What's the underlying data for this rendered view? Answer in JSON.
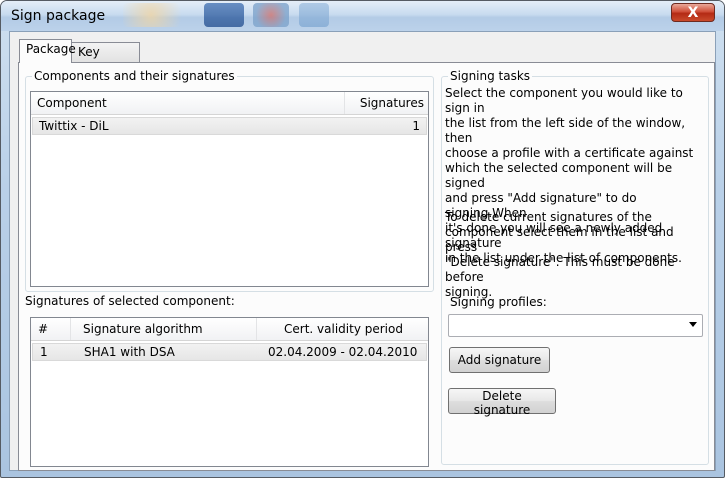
{
  "window": {
    "title": "Sign package",
    "close_label": "X"
  },
  "tabs": [
    {
      "label": "Package",
      "active": true
    },
    {
      "label": "Key pairs",
      "active": false
    }
  ],
  "components": {
    "group_title": "Components and their signatures",
    "headers": {
      "component": "Component",
      "signatures": "Signatures"
    },
    "rows": [
      {
        "component": "Twittix - DiL",
        "signatures": "1"
      }
    ]
  },
  "signatures": {
    "section_label": "Signatures of selected component:",
    "headers": {
      "num": "#",
      "algorithm": "Signature algorithm",
      "validity": "Cert. validity period"
    },
    "rows": [
      {
        "num": "1",
        "algorithm": "SHA1 with DSA",
        "validity": "02.04.2009 - 02.04.2010"
      }
    ]
  },
  "tasks": {
    "group_title": "Signing tasks",
    "description_1": "Select the component you would like to sign in\nthe list from the left side of the window, then\nchoose a profile with a certificate against\nwhich the selected component will be signed\nand press \"Add signature\" to do signing.When\nit's done you will see a newly added signature\nin the list under the list of components.",
    "description_2": "To delete current signatures of the\ncomponent select them in the list and press\n\"Delete signature\". This must be done before\nsigning.",
    "profiles_label": "Signing profiles:",
    "profiles_value": "",
    "add_button": "Add signature",
    "delete_button": "Delete signature"
  },
  "colors": {
    "title_gradient_top": "#e4eef8",
    "close_button": "#c94a2c",
    "selected_row": "#e6e6e6"
  }
}
